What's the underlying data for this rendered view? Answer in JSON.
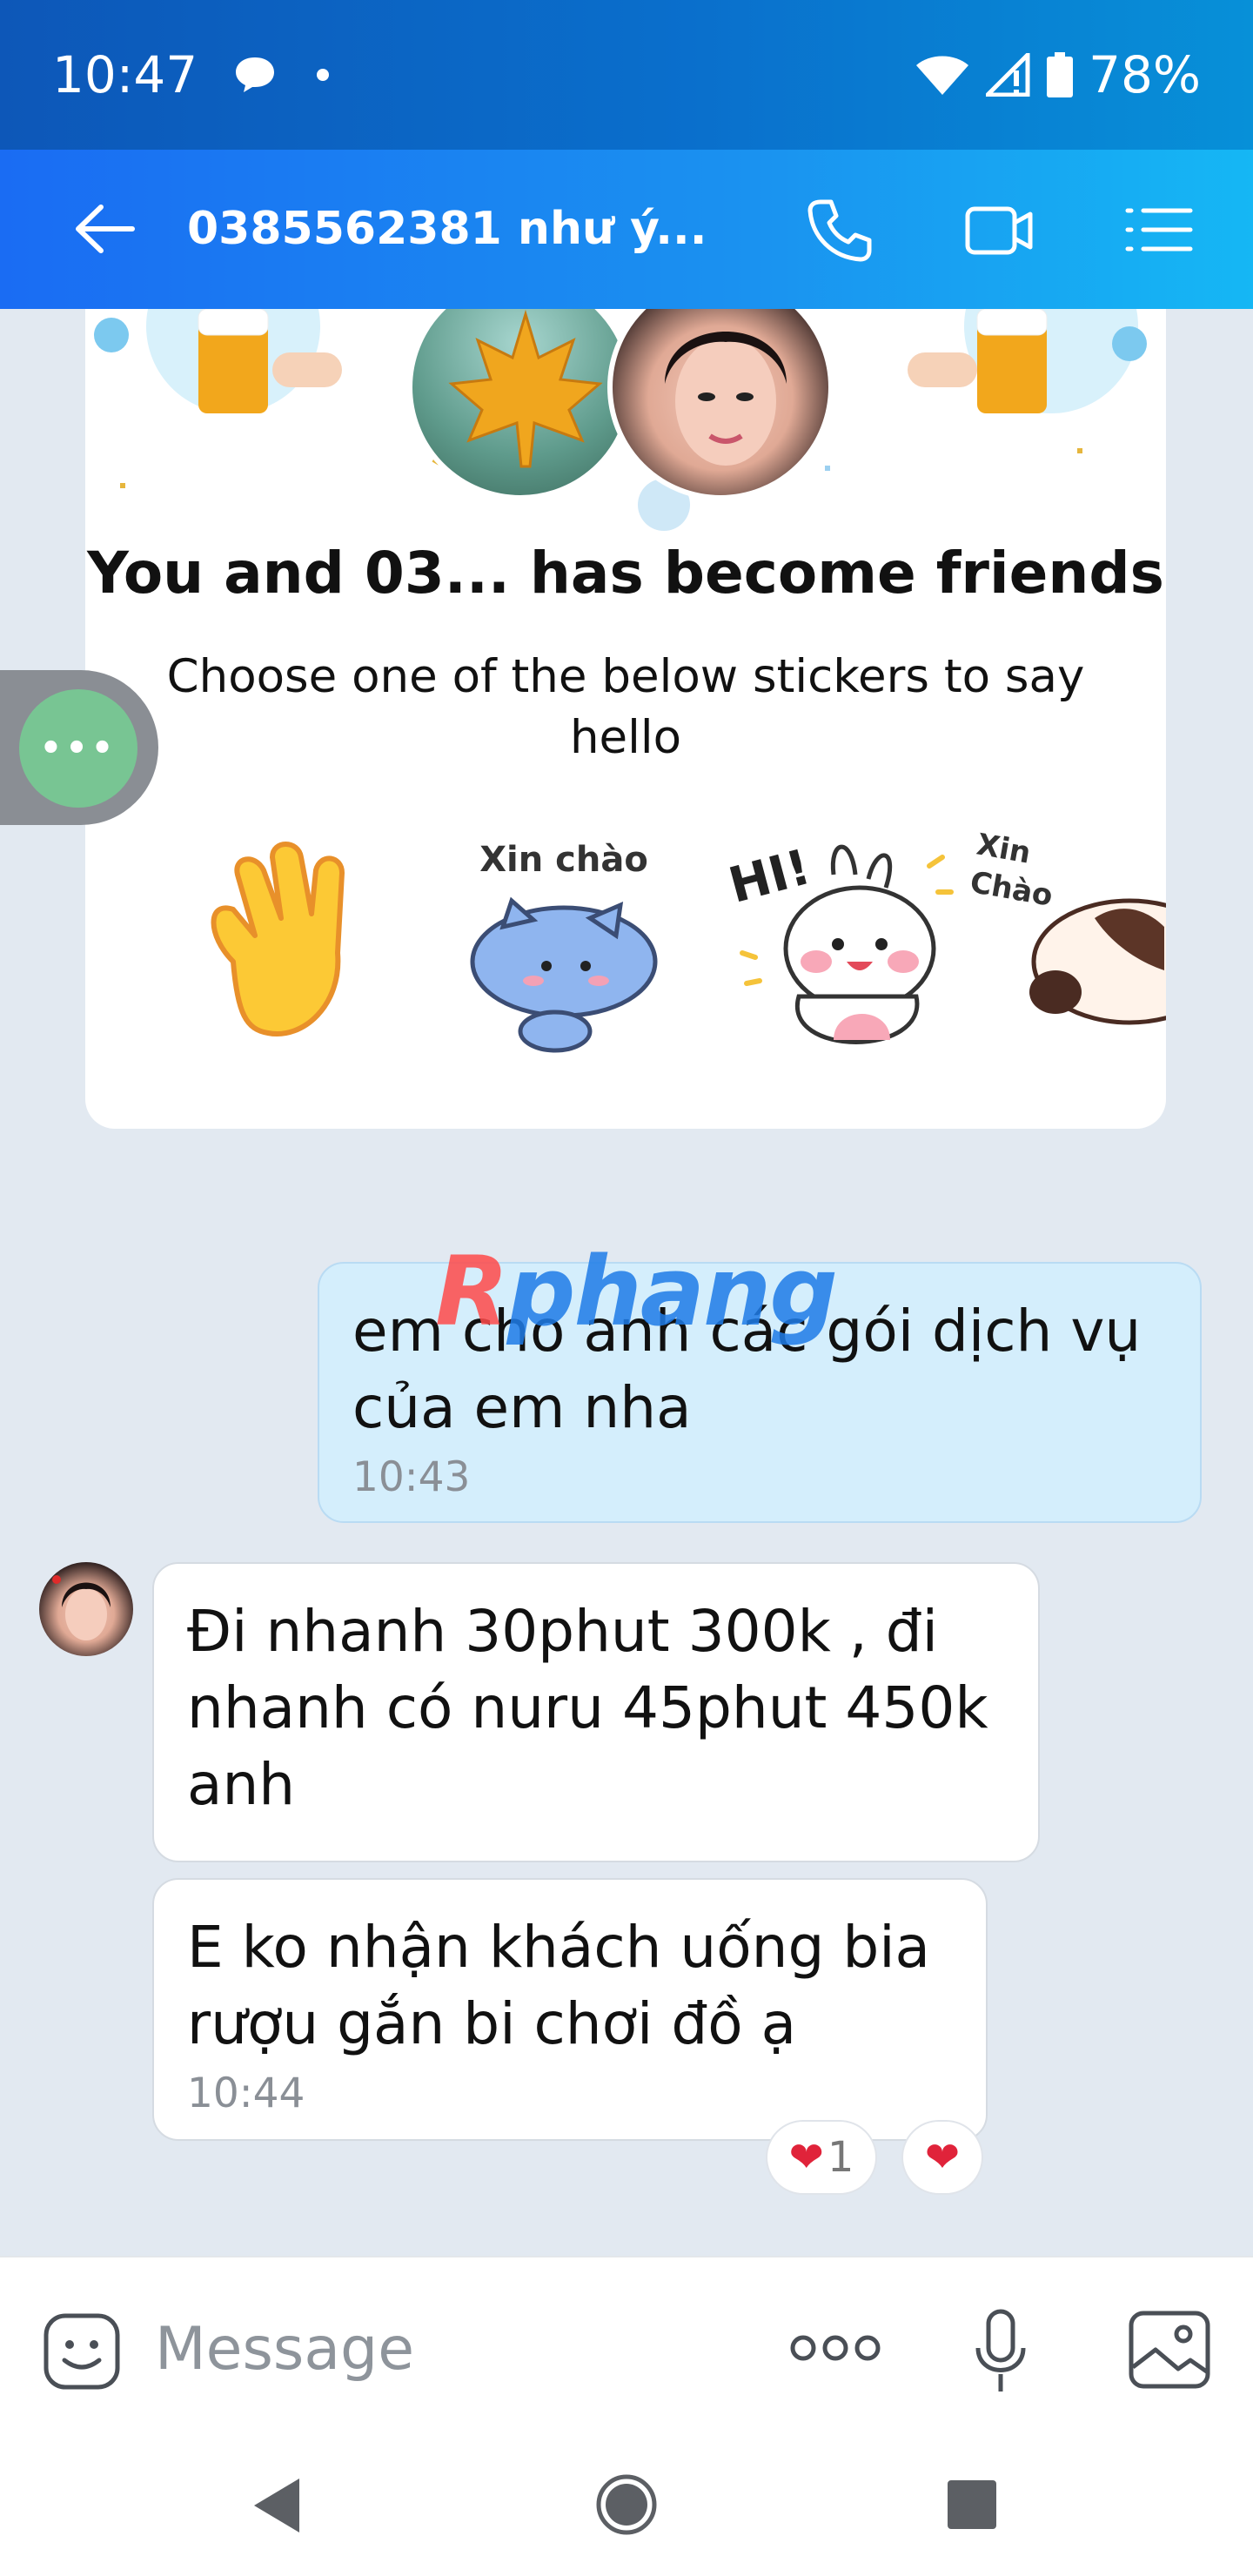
{
  "status_bar": {
    "time": "10:47",
    "battery": "78%",
    "icons": [
      "chat-notification-icon",
      "dot-icon",
      "wifi-icon",
      "signal-icon",
      "battery-icon"
    ]
  },
  "header": {
    "title": "0385562381 như ý...",
    "icons": [
      "back-arrow-icon",
      "phone-icon",
      "video-call-icon",
      "menu-list-icon"
    ]
  },
  "friend_card": {
    "headline": "You and 03...  has become friends",
    "subline": "Choose one of the below stickers to say hello",
    "stickers": [
      {
        "name": "waving-hand-sticker",
        "text": ""
      },
      {
        "name": "blue-cat-sticker",
        "text": "Xin chào"
      },
      {
        "name": "bunny-sticker",
        "text": "HI!"
      },
      {
        "name": "cow-sticker",
        "text": "Xin Chào"
      }
    ]
  },
  "floating_button": {
    "label": "•••"
  },
  "watermark": {
    "text_r": "R",
    "text_rest": "phang"
  },
  "messages": [
    {
      "side": "sent",
      "text": "em cho anh các gói dịch vụ của em nha",
      "time": "10:43"
    },
    {
      "side": "received",
      "text": "Đi nhanh 30phut 300k , đi nhanh có nuru 45phut 450k anh",
      "time": ""
    },
    {
      "side": "received",
      "text": "E ko nhận khách uống bia rượu gắn bi chơi đồ ạ",
      "time": "10:44"
    }
  ],
  "reactions": [
    {
      "emoji": "❤",
      "count": "1"
    },
    {
      "emoji": "❤",
      "count": ""
    }
  ],
  "input": {
    "placeholder": "Message",
    "icons": [
      "emoji-icon",
      "more-options-icon",
      "microphone-icon",
      "image-icon"
    ]
  },
  "nav": {
    "icons": [
      "back-triangle-icon",
      "home-circle-icon",
      "recents-square-icon"
    ]
  },
  "colors": {
    "header_start": "#1a6cf3",
    "header_end": "#15b7f4",
    "sent_bubble": "#d4eefc",
    "background": "#e2e9f1"
  }
}
